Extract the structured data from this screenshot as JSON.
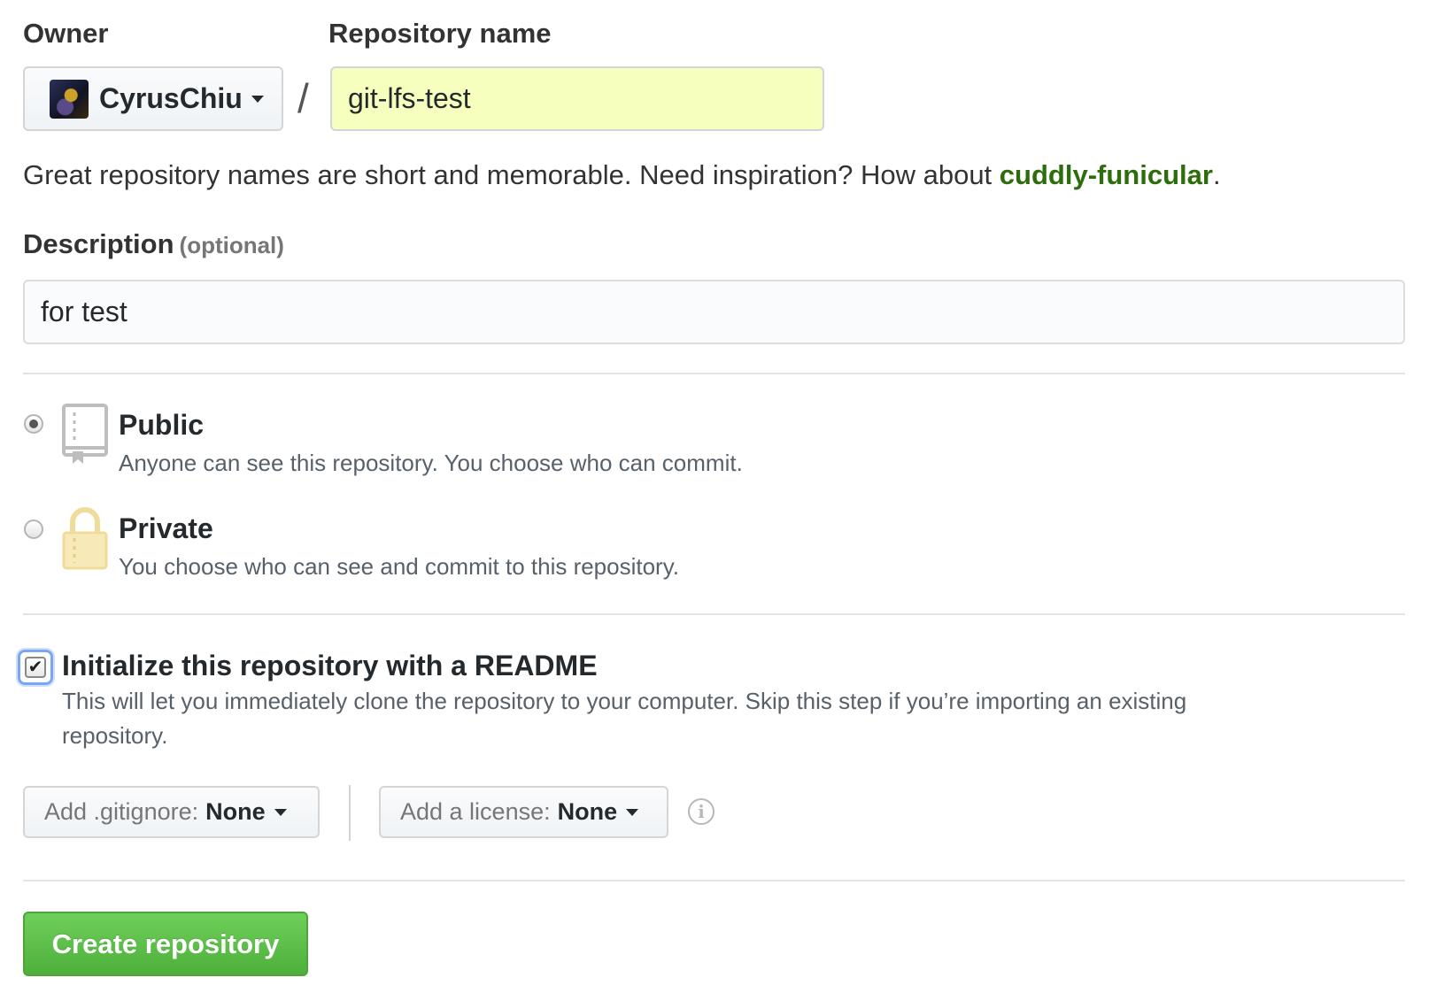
{
  "owner": {
    "label": "Owner",
    "selected": "CyrusChiu"
  },
  "repository": {
    "label": "Repository name",
    "value": "git-lfs-test",
    "separator": "/"
  },
  "hint": {
    "prefix": "Great repository names are short and memorable. Need inspiration? How about ",
    "suggestion": "cuddly-funicular",
    "suffix": "."
  },
  "description": {
    "label": "Description",
    "optional": "(optional)",
    "value": "for test"
  },
  "visibility": {
    "selected": "public",
    "public": {
      "title": "Public",
      "desc": "Anyone can see this repository. You choose who can commit.",
      "icon": "repo-book-icon"
    },
    "private": {
      "title": "Private",
      "desc": "You choose who can see and commit to this repository.",
      "icon": "lock-icon"
    }
  },
  "readme": {
    "checked": true,
    "title": "Initialize this repository with a README",
    "desc_line1": "This will let you immediately clone the repository to your computer. Skip this step if you’re importing an existing",
    "desc_line2": "repository."
  },
  "gitignore": {
    "label": "Add .gitignore:",
    "value": "None"
  },
  "license": {
    "label": "Add a license:",
    "value": "None"
  },
  "info_icon": "info-icon",
  "create_button": "Create repository",
  "colors": {
    "primary_button": "#4db03a",
    "suggestion_link": "#2c6e0b",
    "repo_input_bg": "#f7ffbe",
    "lock_icon": "#f0dc9a"
  }
}
